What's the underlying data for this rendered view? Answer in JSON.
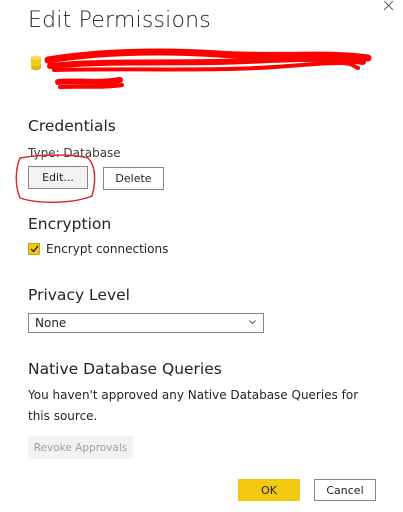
{
  "dialog": {
    "title": "Edit Permissions",
    "close_icon": "close-icon"
  },
  "data_source": {
    "icon": "database-icon",
    "name_redacted": true,
    "redaction_color": "#ff0000"
  },
  "credentials": {
    "heading": "Credentials",
    "type_text": "Type: Database",
    "edit_label": "Edit...",
    "delete_label": "Delete"
  },
  "annotation": {
    "color": "#e0202a"
  },
  "encryption": {
    "heading": "Encryption",
    "checkbox_label": "Encrypt connections",
    "checked": true
  },
  "privacy": {
    "heading": "Privacy Level",
    "selected": "None",
    "chevron_icon": "chevron-down-icon"
  },
  "native_queries": {
    "heading": "Native Database Queries",
    "text": "You haven't approved any Native Database Queries for this source.",
    "revoke_label": "Revoke Approvals",
    "revoke_enabled": false
  },
  "footer": {
    "ok_label": "OK",
    "cancel_label": "Cancel"
  },
  "colors": {
    "accent_yellow": "#f2c811",
    "text": "#252423",
    "border": "#8a8886",
    "disabled_bg": "#f3f2f1",
    "disabled_text": "#a19f9d"
  }
}
